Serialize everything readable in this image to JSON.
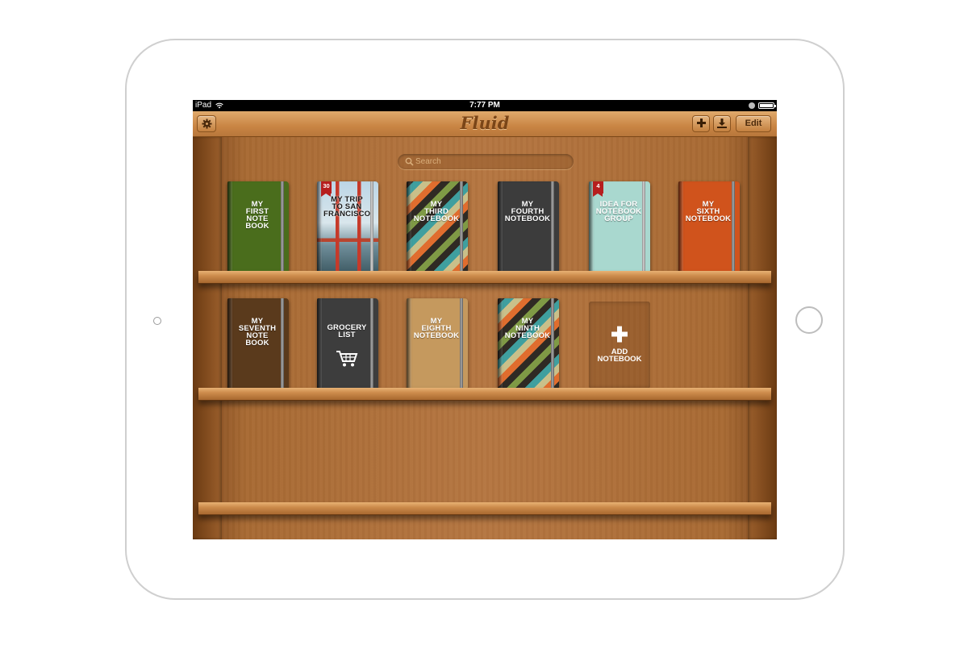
{
  "status_bar": {
    "carrier": "iPad",
    "time": "7:77 PM"
  },
  "navbar": {
    "app_name": "Fluid",
    "edit_label": "Edit"
  },
  "search": {
    "placeholder": "Search"
  },
  "shelves": [
    {
      "books": [
        {
          "title": "MY\nFIRST\nNOTE\nBOOK",
          "cover": "green",
          "color": "#4a6d1c"
        },
        {
          "title": "MY TRIP\nTO SAN\nFRANCISCO",
          "cover": "golden-gate-photo",
          "badge": "30"
        },
        {
          "title": "MY\nTHIRD\nNOTEBOOK",
          "cover": "stripes"
        },
        {
          "title": "MY\nFOURTH\nNOTEBOOK",
          "cover": "charcoal",
          "color": "#3c3c3c"
        },
        {
          "title": "IDEA FOR\nNOTEBOOK\nGROUP",
          "cover": "mint",
          "color": "#a9d8cf",
          "badge": "4"
        },
        {
          "title": "MY\nSIXTH\nNOTEBOOK",
          "cover": "orange",
          "color": "#d0531c"
        }
      ]
    },
    {
      "books": [
        {
          "title": "MY\nSEVENTH\nNOTE\nBOOK",
          "cover": "brown",
          "color": "#5a3a1c"
        },
        {
          "title": "GROCERY\nLIST",
          "cover": "charcoal",
          "color": "#3d3d3d",
          "icon": "shopping-cart-icon"
        },
        {
          "title": "MY\nEIGHTH\nNOTEBOOK",
          "cover": "kraft",
          "color": "#c5995e"
        },
        {
          "title": "MY\nNINTH\nNOTEBOOK",
          "cover": "stripes"
        }
      ],
      "add_tile": {
        "label": "ADD\nNOTEBOOK"
      }
    }
  ],
  "icons": [
    "wifi-icon",
    "lock-icon",
    "battery-icon",
    "gear-icon",
    "plus-icon",
    "download-icon",
    "search-icon",
    "shopping-cart-icon"
  ]
}
